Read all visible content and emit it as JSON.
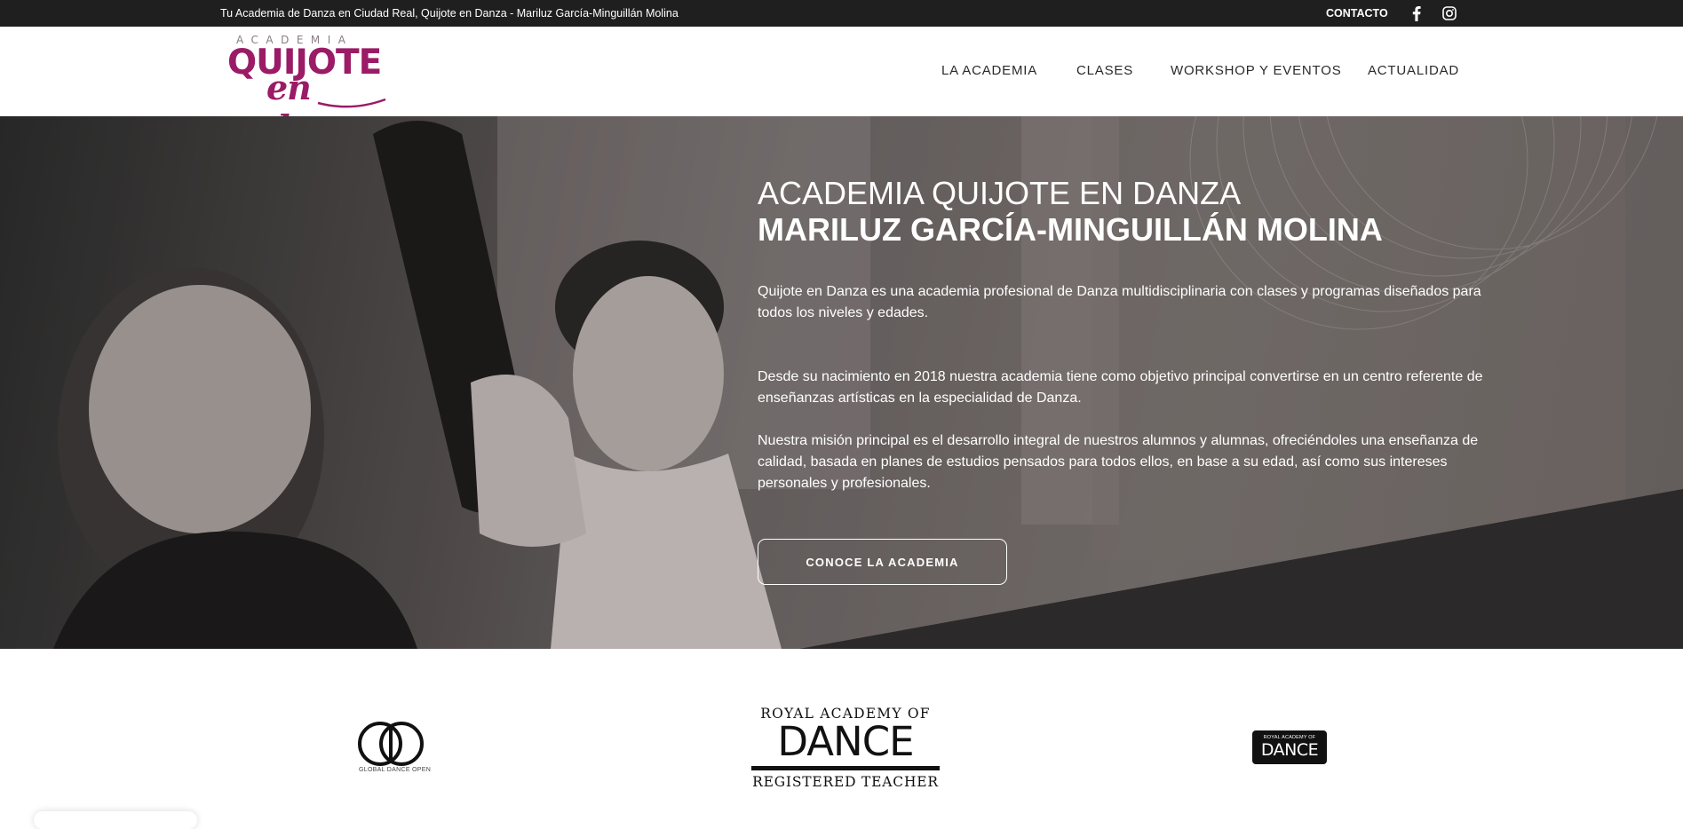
{
  "topbar": {
    "tagline": "Tu Academia de Danza en Ciudad Real, Quijote en Danza - Mariluz García-Minguillán Molina",
    "contact_label": "CONTACTO",
    "social": [
      "facebook-icon",
      "instagram-icon"
    ]
  },
  "logo": {
    "small": "ACADEMIA",
    "big": "QUIJOTE",
    "script": "en danza"
  },
  "nav": {
    "items": [
      {
        "label": "LA ACADEMIA"
      },
      {
        "label": "CLASES"
      },
      {
        "label": "WORKSHOP Y EVENTOS"
      },
      {
        "label": "ACTUALIDAD"
      }
    ]
  },
  "hero": {
    "title": "ACADEMIA QUIJOTE EN DANZA",
    "subtitle": "MARILUZ GARCÍA-MINGUILLÁN MOLINA",
    "paragraphs": [
      "Quijote en Danza es una academia profesional de Danza multidisciplinaria con clases y programas diseñados para todos los niveles y edades.",
      "Desde su nacimiento en 2018 nuestra academia tiene como objetivo principal convertirse en un centro referente de enseñanzas artísticas en la especialidad de Danza.",
      "Nuestra misión principal es el desarrollo integral de nuestros alumnos y alumnas, ofreciéndoles una enseñanza de calidad, basada en planes de estudios pensados para todos ellos, en base a su edad, así como sus intereses personales y profesionales."
    ],
    "cta_label": "CONOCE LA ACADEMIA"
  },
  "partners": {
    "gdo_caption": "GLOBAL DANCE OPEN",
    "rad_line1": "ROYAL ACADEMY OF",
    "rad_line2": "DANCE",
    "rad_line3": "REGISTERED TEACHER",
    "rad_small_line1": "ROYAL ACADEMY OF",
    "rad_small_line2": "DANCE"
  },
  "colors": {
    "brand": "#9b1b66",
    "topbar": "#1f1f1f"
  }
}
